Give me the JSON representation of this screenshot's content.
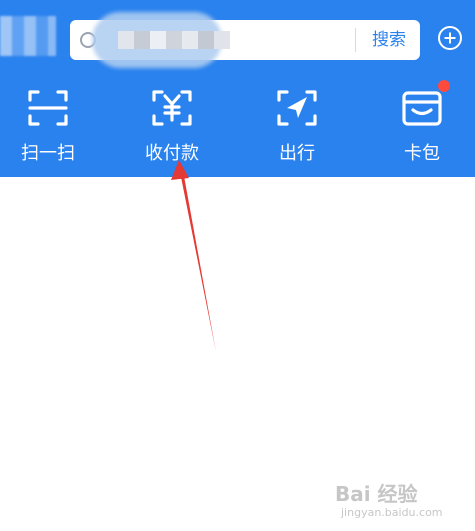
{
  "colors": {
    "header_bg": "#2A82EE",
    "accent": "#2A82EE",
    "badge": "#FF4A3D",
    "annotation_arrow": "#E53935"
  },
  "search": {
    "placeholder": "",
    "button_label": "搜索",
    "value_obscured": true
  },
  "header": {
    "add_icon": "plus-circle-icon"
  },
  "actions": [
    {
      "label": "扫一扫",
      "icon": "scan-icon"
    },
    {
      "label": "收付款",
      "icon": "payment-yuan-icon"
    },
    {
      "label": "出行",
      "icon": "travel-arrow-icon"
    },
    {
      "label": "卡包",
      "icon": "card-wallet-icon",
      "badge": true
    }
  ],
  "watermark": {
    "main": "Bai 经验",
    "sub": "jingyan.baidu.com"
  }
}
